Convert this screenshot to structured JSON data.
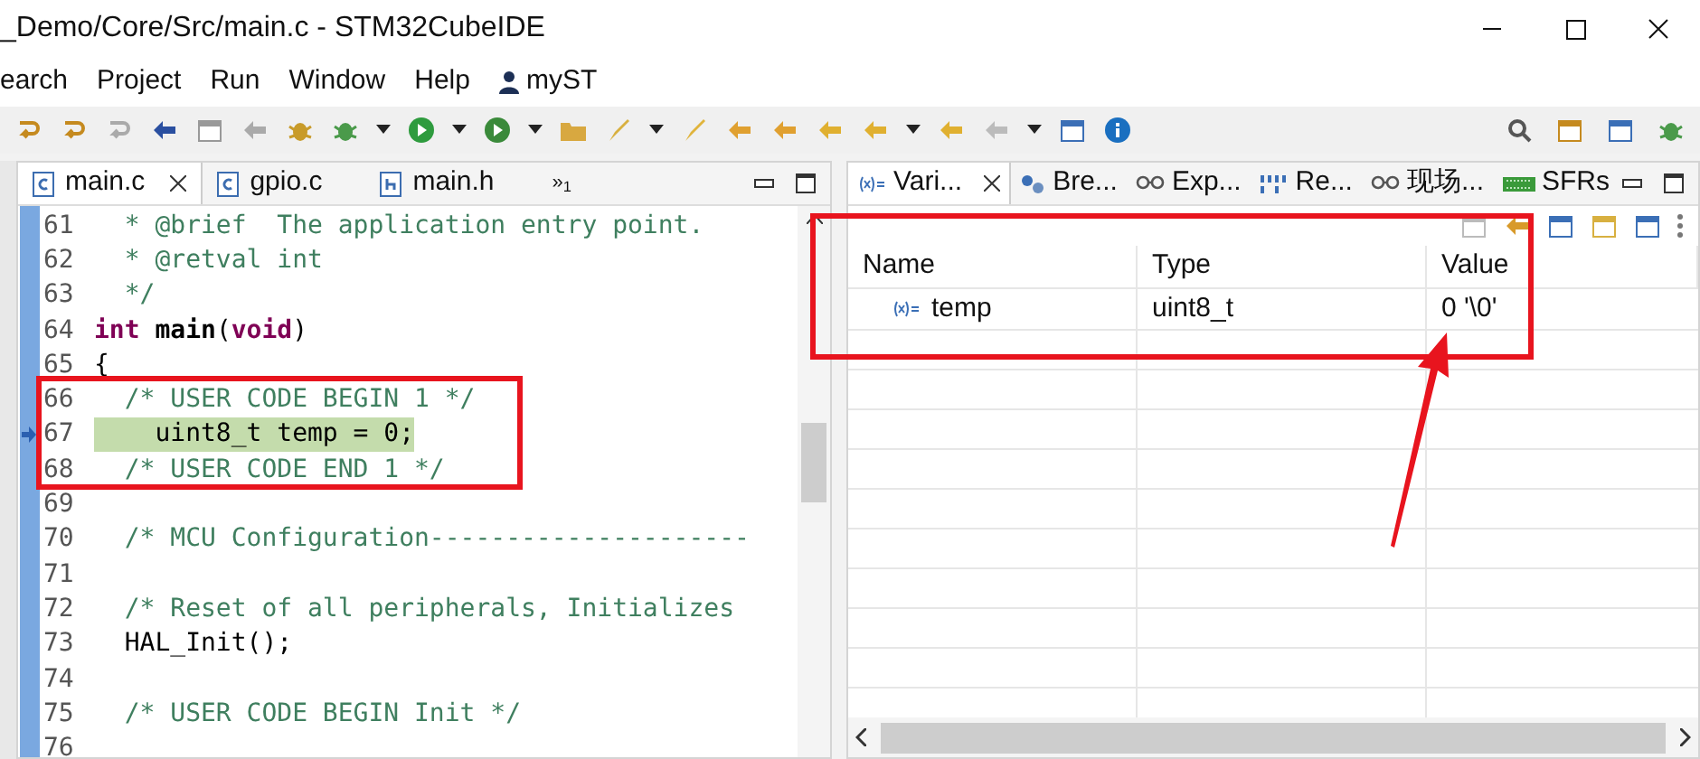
{
  "window": {
    "title": "_Demo/Core/Src/main.c - STM32CubeIDE"
  },
  "menu": [
    {
      "label": "earch",
      "kind": "plain"
    },
    {
      "label": "Project",
      "kind": "plain"
    },
    {
      "label": "Run",
      "kind": "plain"
    },
    {
      "label": "Window",
      "kind": "plain"
    },
    {
      "label": "Help",
      "kind": "plain"
    },
    {
      "label": "myST",
      "kind": "user"
    }
  ],
  "editor": {
    "tabs": [
      {
        "label": "main.c",
        "kind": "c",
        "selected": true
      },
      {
        "label": "gpio.c",
        "kind": "c",
        "selected": false
      },
      {
        "label": "main.h",
        "kind": "h",
        "selected": false
      }
    ],
    "overflow": {
      "symbol": "»",
      "count": "1"
    },
    "lines": [
      {
        "number": "61",
        "highlighted": false,
        "segments": [
          {
            "kind": "comment",
            "text": "  * @brief  The application entry point."
          }
        ]
      },
      {
        "number": "62",
        "highlighted": false,
        "segments": [
          {
            "kind": "comment",
            "text": "  * @retval int"
          }
        ]
      },
      {
        "number": "63",
        "highlighted": false,
        "segments": [
          {
            "kind": "comment",
            "text": "  */"
          }
        ]
      },
      {
        "number": "64",
        "highlighted": false,
        "segments": [
          {
            "kind": "keyword",
            "text": "int "
          },
          {
            "kind": "bold",
            "text": "main"
          },
          {
            "kind": "plain",
            "text": "("
          },
          {
            "kind": "keyword",
            "text": "void"
          },
          {
            "kind": "plain",
            "text": ")"
          }
        ]
      },
      {
        "number": "65",
        "highlighted": false,
        "segments": [
          {
            "kind": "plain",
            "text": "{"
          }
        ]
      },
      {
        "number": "66",
        "highlighted": false,
        "segments": [
          {
            "kind": "comment",
            "text": "  /* USER CODE BEGIN 1 */"
          }
        ]
      },
      {
        "number": "67",
        "highlighted": true,
        "segments": [
          {
            "kind": "plain",
            "text": "    uint8_t temp = 0;"
          }
        ]
      },
      {
        "number": "68",
        "highlighted": false,
        "segments": [
          {
            "kind": "comment",
            "text": "  /* USER CODE END 1 */"
          }
        ]
      },
      {
        "number": "69"
      },
      {
        "number": "70",
        "highlighted": false,
        "segments": [
          {
            "kind": "comment",
            "text": "  /* MCU Configuration---------------------"
          }
        ]
      },
      {
        "number": "71"
      },
      {
        "number": "72",
        "highlighted": false,
        "segments": [
          {
            "kind": "comment",
            "text": "  /* Reset of all peripherals, Initializes"
          }
        ]
      },
      {
        "number": "73",
        "highlighted": false,
        "segments": [
          {
            "kind": "plain",
            "text": "  HAL_Init();"
          }
        ]
      },
      {
        "number": "74"
      },
      {
        "number": "75",
        "highlighted": false,
        "segments": [
          {
            "kind": "comment",
            "text": "  /* USER CODE BEGIN Init */"
          }
        ]
      },
      {
        "number": "76"
      }
    ]
  },
  "variables_view": {
    "tabs": [
      {
        "label": "Vari...",
        "kind": "variables",
        "selected": true
      },
      {
        "label": "Bre...",
        "kind": "breakpoints",
        "selected": false
      },
      {
        "label": "Exp...",
        "kind": "expressions",
        "selected": false
      },
      {
        "label": "Re...",
        "kind": "registers",
        "selected": false
      },
      {
        "label": "现场...",
        "kind": "expressions",
        "selected": false
      },
      {
        "label": "SFRs",
        "kind": "sfr",
        "selected": false
      }
    ],
    "columns": [
      "Name",
      "Type",
      "Value"
    ],
    "rows": [
      {
        "name": "temp",
        "type": "uint8_t",
        "value": "0 '\\0'"
      }
    ]
  }
}
